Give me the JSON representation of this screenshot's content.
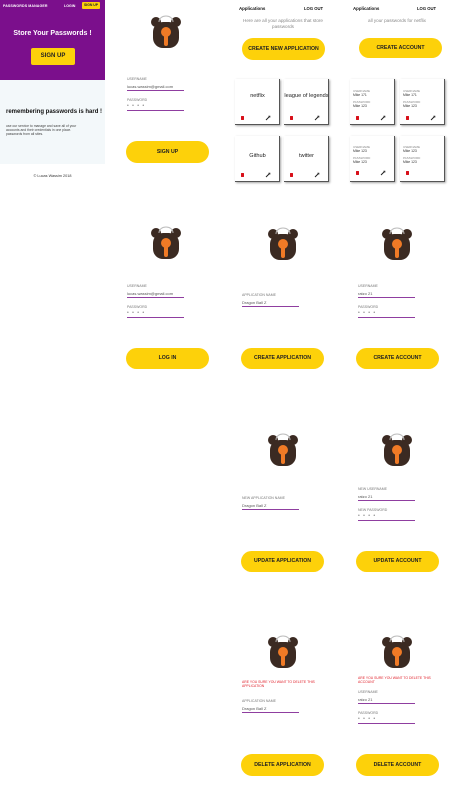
{
  "landing": {
    "brand": "PASSWORDS MANAGER",
    "nav_login": "LOGIN",
    "nav_signup": "SIGN UP",
    "hero_title": "Store Your Passwords !",
    "hero_button": "SIGN UP",
    "section_title": "remembering passwords is hard !",
    "section_text": "use our service to manage and save all of your accounts and their credentials in one place. passwords from all sites.",
    "copyright": "© Lucas Wassim 2018"
  },
  "signup": {
    "username_label": "USERNAME",
    "username_value": "lucas.wassim@gmail.com",
    "password_label": "PASSWORD",
    "password_value": "• • • •",
    "button": "SIGN UP"
  },
  "login": {
    "username_label": "USERNAME",
    "username_value": "lucas.wassim@gmail.com",
    "password_label": "PASSWORD",
    "password_value": "• • • •",
    "button": "LOG IN"
  },
  "applications": {
    "title": "Applications",
    "logout": "LOG OUT",
    "subtitle": "Here are all your applications that store passwords",
    "create_button": "CREATE NEW APPLICATION",
    "items": [
      "netflix",
      "league of legends",
      "Github",
      "twitter"
    ]
  },
  "accounts": {
    "title": "Applications",
    "logout": "LOG OUT",
    "subtitle": "all your passwords for netflix",
    "create_button": "CREATE ACCOUNT",
    "username_label": "USERNAME",
    "password_label": "PASSWORD",
    "items": [
      {
        "username": "Mike 171",
        "password": "Mike 123"
      },
      {
        "username": "Mike 171",
        "password": "Mike 123"
      },
      {
        "username": "Mike 123",
        "password": "Mike 123"
      },
      {
        "username": "Mike 123",
        "password": "Mike 123"
      }
    ]
  },
  "create_app": {
    "label": "APPLICATION NAME",
    "value": "Dragon Ball Z",
    "button": "CREATE APPLICATION"
  },
  "create_account": {
    "username_label": "USERNAME",
    "username_value": "ratzo 21",
    "password_label": "PASSWORD",
    "password_value": "• • • •",
    "button": "CREATE ACCOUNT"
  },
  "update_app": {
    "label": "NEW APPLICATION NAME",
    "value": "Dragon Ball Z",
    "button": "UPDATE APPLICATION"
  },
  "update_account": {
    "username_label": "NEW USERNAME",
    "username_value": "ratzo 21",
    "password_label": "NEW PASSWORD",
    "password_value": "• • • •",
    "button": "UPDATE ACCOUNT"
  },
  "delete_app": {
    "warning": "ARE YOU SURE YOU WANT TO DELETE THIS APPLICATION",
    "label": "APPLICATION NAME",
    "value": "Dragon Ball Z",
    "button": "DELETE APPLICATION"
  },
  "delete_account": {
    "warning": "ARE YOU SURE YOU WANT TO DELETE THIS ACCOUNT",
    "username_label": "USERNAME",
    "username_value": "ratzo 21",
    "password_label": "PASSWORD",
    "password_value": "• • • •",
    "button": "DELETE ACCOUNT"
  },
  "colors": {
    "brand_purple": "#7b0f8c",
    "accent_yellow": "#fdd10a",
    "danger_red": "#e0202a",
    "bear_brown": "#3b2a22",
    "keyhole_orange": "#f07a26"
  },
  "icons": [
    "bear-lock-logo",
    "trash-icon",
    "wrench-icon"
  ]
}
